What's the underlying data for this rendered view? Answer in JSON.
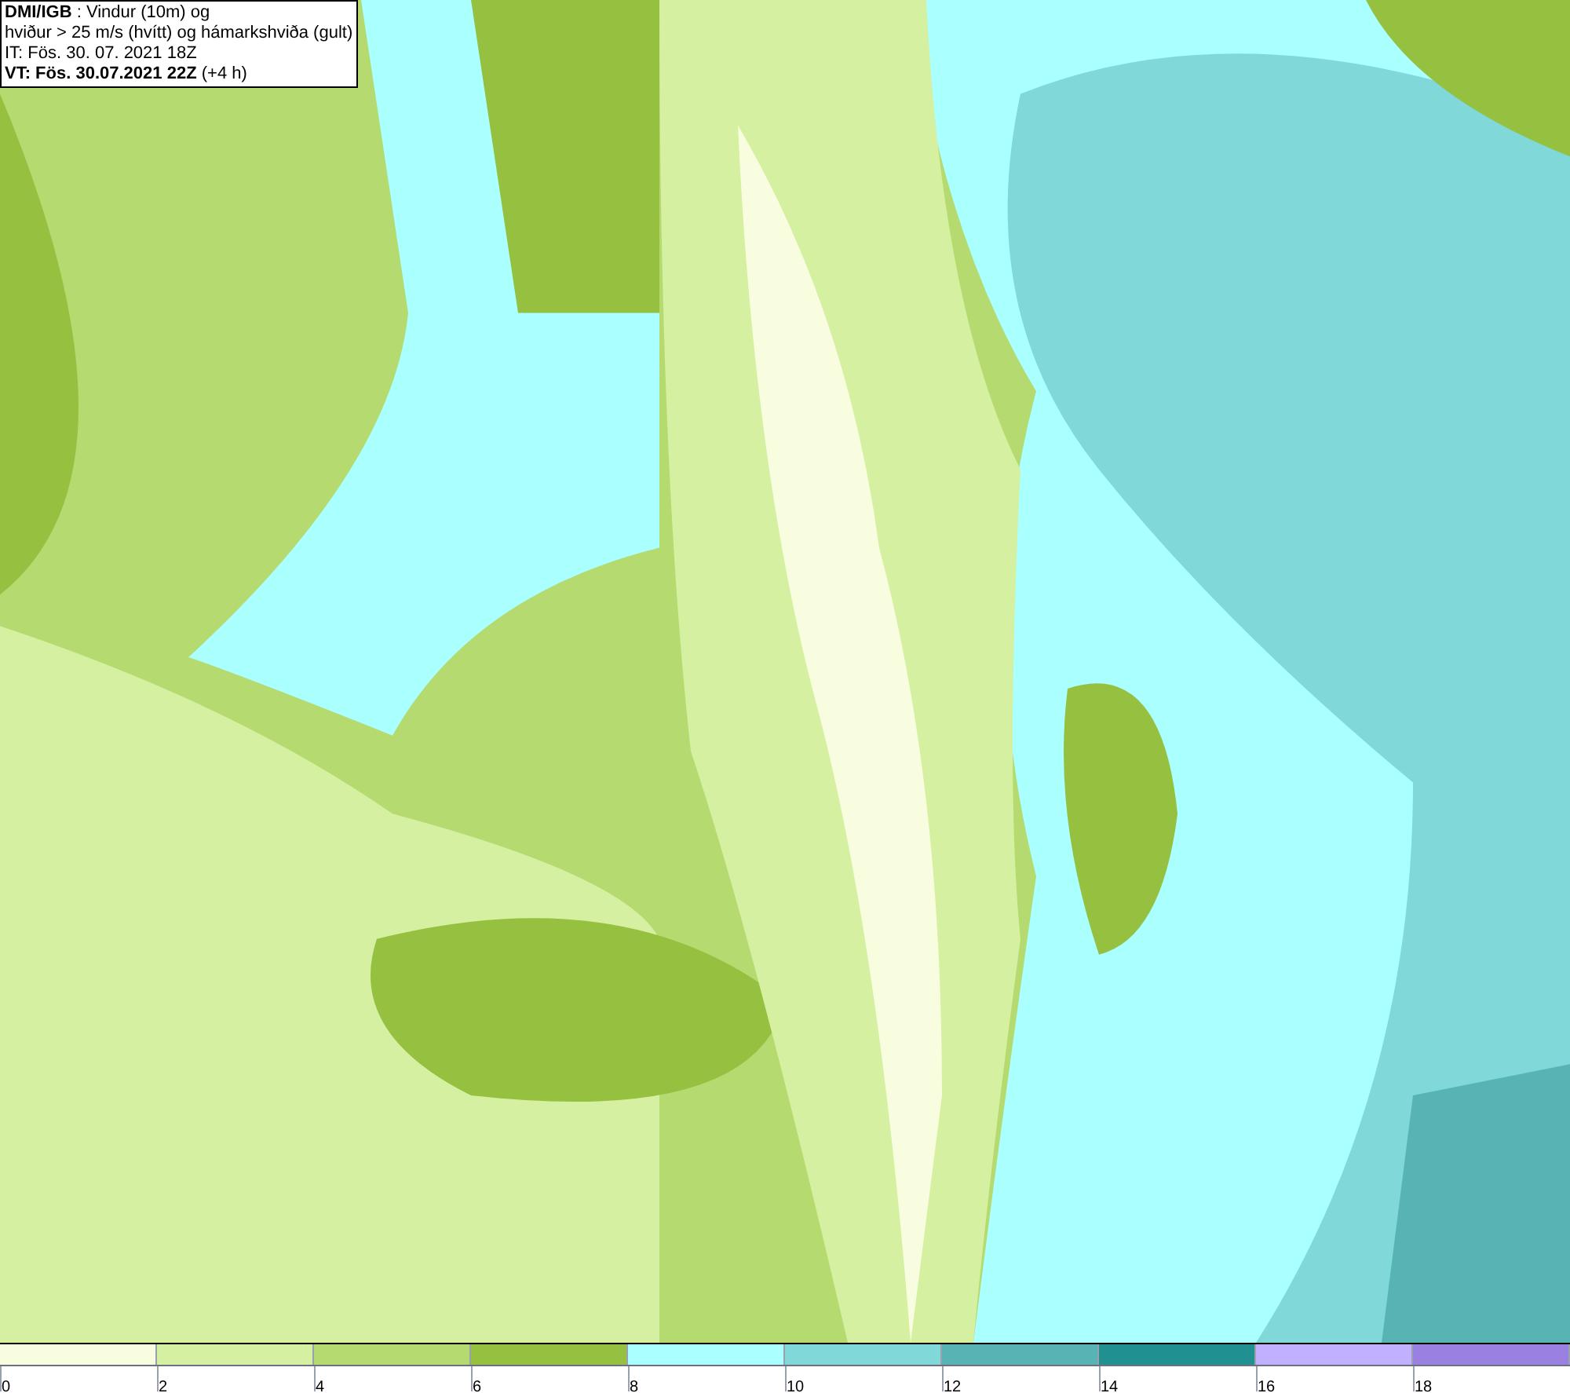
{
  "info_box": {
    "lines": [
      "**DMI/IGB** : Vindur (10m) og",
      "hviður > 25 m/s (hvítt) og hámarkshviða (gult)",
      "IT: Fös. 30. 07. 2021 18Z",
      "**VT: Fös. 30.07.2021 22Z** (+4 h)"
    ]
  },
  "legend": {
    "bins": [
      {
        "label": "0",
        "color": "#f8fde0"
      },
      {
        "label": "2",
        "color": "#d4f0a0"
      },
      {
        "label": "4",
        "color": "#b5da70"
      },
      {
        "label": "6",
        "color": "#96c040"
      },
      {
        "label": "8",
        "color": "#aaffff"
      },
      {
        "label": "10",
        "color": "#80d8d8"
      },
      {
        "label": "12",
        "color": "#58b4b4"
      },
      {
        "label": "14",
        "color": "#209090"
      },
      {
        "label": "16",
        "color": "#c0b0ff"
      },
      {
        "label": "18",
        "color": "#9a80e0"
      }
    ]
  }
}
